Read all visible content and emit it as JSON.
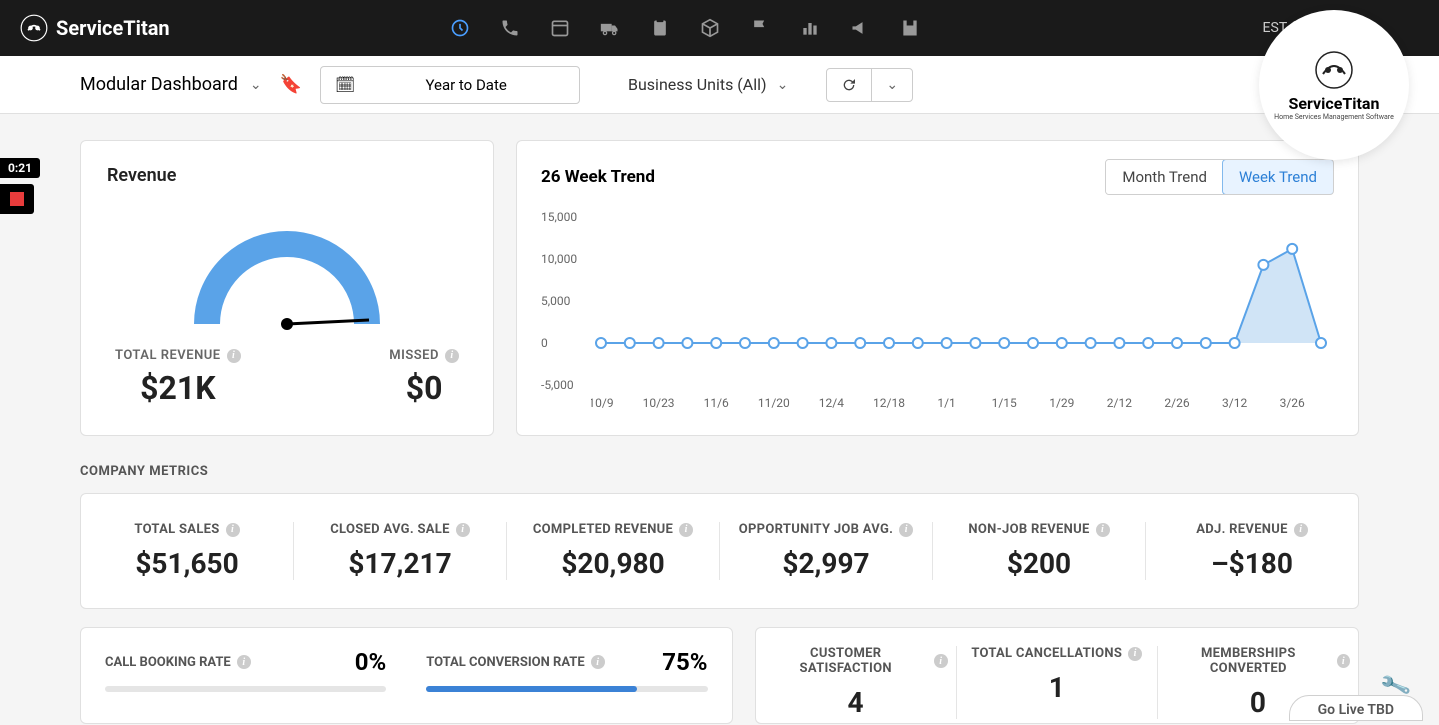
{
  "brand": "ServiceTitan",
  "timezone": "EST (+1 hrs)",
  "watermark": {
    "title": "ServiceTitan",
    "subtitle": "Home Services Management Software"
  },
  "filters": {
    "dashboard_name": "Modular Dashboard",
    "date_range": "Year to Date",
    "business_units": "Business Units (All)"
  },
  "revenue": {
    "title": "Revenue",
    "total_label": "TOTAL REVENUE",
    "total_value": "$21K",
    "missed_label": "MISSED",
    "missed_value": "$0"
  },
  "trend": {
    "title": "26 Week Trend",
    "toggle_month": "Month Trend",
    "toggle_week": "Week Trend",
    "y_ticks": [
      "15,000",
      "10,000",
      "5,000",
      "0",
      "-5,000"
    ]
  },
  "section_company_metrics": "COMPANY METRICS",
  "metrics": [
    {
      "label": "TOTAL SALES",
      "value": "$51,650"
    },
    {
      "label": "CLOSED AVG. SALE",
      "value": "$17,217"
    },
    {
      "label": "COMPLETED REVENUE",
      "value": "$20,980"
    },
    {
      "label": "OPPORTUNITY JOB AVG.",
      "value": "$2,997"
    },
    {
      "label": "NON-JOB REVENUE",
      "value": "$200"
    },
    {
      "label": "ADJ. REVENUE",
      "value": "–$180"
    }
  ],
  "rates": {
    "booking_label": "CALL BOOKING RATE",
    "booking_value": "0%",
    "conversion_label": "TOTAL CONVERSION RATE",
    "conversion_value": "75%"
  },
  "bottom_stats": [
    {
      "label": "CUSTOMER SATISFACTION",
      "value": "4"
    },
    {
      "label": "TOTAL CANCELLATIONS",
      "value": "1"
    },
    {
      "label": "MEMBERSHIPS CONVERTED",
      "value": "0"
    }
  ],
  "timer": "0:21",
  "golive": "Go Live TBD",
  "chart_data": {
    "type": "line",
    "title": "26 Week Trend",
    "ylabel": "",
    "ylim": [
      -5000,
      15000
    ],
    "x": [
      "10/9",
      "10/16",
      "10/23",
      "10/30",
      "11/6",
      "11/13",
      "11/20",
      "11/27",
      "12/4",
      "12/11",
      "12/18",
      "12/25",
      "1/1",
      "1/8",
      "1/15",
      "1/22",
      "1/29",
      "2/5",
      "2/12",
      "2/19",
      "2/26",
      "3/5",
      "3/12",
      "3/19",
      "3/26",
      "4/2"
    ],
    "x_ticks": [
      "10/9",
      "10/23",
      "11/6",
      "11/20",
      "12/4",
      "12/18",
      "1/1",
      "1/15",
      "1/29",
      "2/12",
      "2/26",
      "3/12",
      "3/26"
    ],
    "values": [
      0,
      0,
      0,
      0,
      0,
      0,
      0,
      0,
      0,
      0,
      0,
      0,
      0,
      0,
      0,
      0,
      0,
      0,
      0,
      0,
      0,
      0,
      0,
      9300,
      11200,
      0
    ]
  }
}
